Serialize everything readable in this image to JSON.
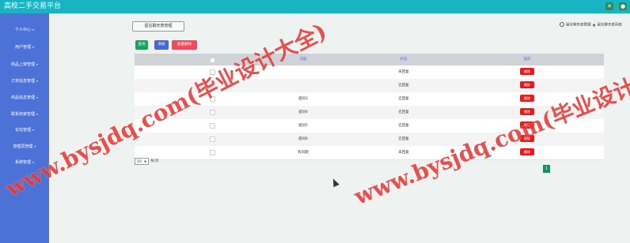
{
  "app": {
    "title": "高校二手交易平台",
    "top_icons": [
      "swap-icon",
      "user-icon"
    ]
  },
  "sidebar": {
    "items": [
      {
        "label": "个人中心"
      },
      {
        "label": "用户管理"
      },
      {
        "label": "商品上架管理"
      },
      {
        "label": "订单信息管理"
      },
      {
        "label": "商品信息管理"
      },
      {
        "label": "联系商家管理"
      },
      {
        "label": "论坛管理"
      },
      {
        "label": "管理员管理"
      },
      {
        "label": "系统管理"
      }
    ]
  },
  "page": {
    "title_button": "留言聊天表管理",
    "breadcrumb": {
      "home_label": "留言聊天表管理",
      "current": "留言聊天表列表"
    }
  },
  "toolbar": {
    "search": "查询",
    "add": "添加",
    "batch_delete": "批量删除"
  },
  "table": {
    "headers": {
      "question": "问题",
      "status": "状态",
      "action": "操作"
    },
    "rows": [
      {
        "question": "",
        "status": "未回复",
        "action": "删除"
      },
      {
        "question": "",
        "status": "已回复",
        "action": "删除"
      },
      {
        "question": "提问3",
        "status": "已回复",
        "action": "删除"
      },
      {
        "question": "提问4",
        "status": "已回复",
        "action": "删除"
      },
      {
        "question": "提问5",
        "status": "已回复",
        "action": "删除"
      },
      {
        "question": "提问6",
        "status": "已回复",
        "action": "删除"
      },
      {
        "question": "有问题",
        "status": "未回复",
        "action": "删除"
      }
    ]
  },
  "pagination": {
    "page_size": "10",
    "page_size_suffix": "条/页",
    "current_page": "1"
  },
  "watermarks": [
    "www.bysjdq.com(毕业设计大全)",
    "www.bysjdq.com(毕业设计大全)"
  ],
  "colors": {
    "topbar": "#19b4c4",
    "sidebar": "#4c72d8",
    "search": "#19a35b",
    "add": "#4b64d6",
    "batch_delete": "#ef4b5e",
    "delete": "#e41c1c",
    "watermark": "#e53935"
  }
}
